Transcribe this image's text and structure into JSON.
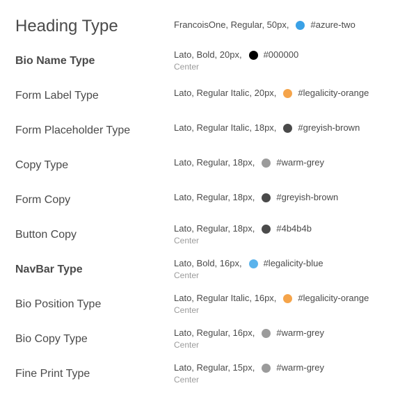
{
  "styles": [
    {
      "name": "Heading Type",
      "spec": "FrancoisOne, Regular, 50px,",
      "color_name": "#azure-two",
      "color": "#3aa1e6",
      "note": ""
    },
    {
      "name": "Bio Name Type",
      "spec": "Lato, Bold, 20px,",
      "color_name": "#000000",
      "color": "#000000",
      "note": "Center"
    },
    {
      "name": "Form Label Type",
      "spec": "Lato, Regular Italic, 20px,",
      "color_name": "#legalicity-orange",
      "color": "#f5a44a",
      "note": ""
    },
    {
      "name": "Form Placeholder Type",
      "spec": "Lato, Regular Italic, 18px,",
      "color_name": "#greyish-brown",
      "color": "#4a4a4a",
      "note": ""
    },
    {
      "name": "Copy Type",
      "spec": "Lato, Regular, 18px,",
      "color_name": "#warm-grey",
      "color": "#9b9b9b",
      "note": ""
    },
    {
      "name": "Form Copy",
      "spec": "Lato, Regular, 18px,",
      "color_name": "#greyish-brown",
      "color": "#4a4a4a",
      "note": ""
    },
    {
      "name": "Button Copy",
      "spec": "Lato, Regular, 18px,",
      "color_name": "#4b4b4b",
      "color": "#4b4b4b",
      "note": "Center"
    },
    {
      "name": "NavBar Type",
      "spec": "Lato, Bold, 16px,",
      "color_name": "#legalicity-blue",
      "color": "#5ab3ec",
      "note": "Center"
    },
    {
      "name": "Bio Position Type",
      "spec": "Lato, Regular Italic, 16px,",
      "color_name": "#legalicity-orange",
      "color": "#f5a44a",
      "note": "Center"
    },
    {
      "name": "Bio Copy Type",
      "spec": "Lato, Regular, 16px,",
      "color_name": "#warm-grey",
      "color": "#9b9b9b",
      "note": "Center"
    },
    {
      "name": "Fine Print Type",
      "spec": "Lato, Regular, 15px,",
      "color_name": "#warm-grey",
      "color": "#9b9b9b",
      "note": "Center"
    }
  ]
}
